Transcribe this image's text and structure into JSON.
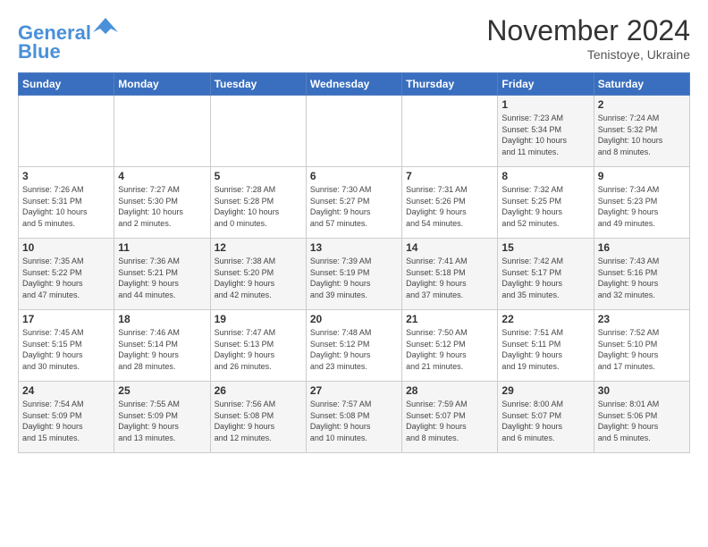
{
  "logo": {
    "line1": "General",
    "line2": "Blue"
  },
  "title": "November 2024",
  "location": "Tenistoye, Ukraine",
  "days_header": [
    "Sunday",
    "Monday",
    "Tuesday",
    "Wednesday",
    "Thursday",
    "Friday",
    "Saturday"
  ],
  "weeks": [
    [
      {
        "day": "",
        "info": ""
      },
      {
        "day": "",
        "info": ""
      },
      {
        "day": "",
        "info": ""
      },
      {
        "day": "",
        "info": ""
      },
      {
        "day": "",
        "info": ""
      },
      {
        "day": "1",
        "info": "Sunrise: 7:23 AM\nSunset: 5:34 PM\nDaylight: 10 hours\nand 11 minutes."
      },
      {
        "day": "2",
        "info": "Sunrise: 7:24 AM\nSunset: 5:32 PM\nDaylight: 10 hours\nand 8 minutes."
      }
    ],
    [
      {
        "day": "3",
        "info": "Sunrise: 7:26 AM\nSunset: 5:31 PM\nDaylight: 10 hours\nand 5 minutes."
      },
      {
        "day": "4",
        "info": "Sunrise: 7:27 AM\nSunset: 5:30 PM\nDaylight: 10 hours\nand 2 minutes."
      },
      {
        "day": "5",
        "info": "Sunrise: 7:28 AM\nSunset: 5:28 PM\nDaylight: 10 hours\nand 0 minutes."
      },
      {
        "day": "6",
        "info": "Sunrise: 7:30 AM\nSunset: 5:27 PM\nDaylight: 9 hours\nand 57 minutes."
      },
      {
        "day": "7",
        "info": "Sunrise: 7:31 AM\nSunset: 5:26 PM\nDaylight: 9 hours\nand 54 minutes."
      },
      {
        "day": "8",
        "info": "Sunrise: 7:32 AM\nSunset: 5:25 PM\nDaylight: 9 hours\nand 52 minutes."
      },
      {
        "day": "9",
        "info": "Sunrise: 7:34 AM\nSunset: 5:23 PM\nDaylight: 9 hours\nand 49 minutes."
      }
    ],
    [
      {
        "day": "10",
        "info": "Sunrise: 7:35 AM\nSunset: 5:22 PM\nDaylight: 9 hours\nand 47 minutes."
      },
      {
        "day": "11",
        "info": "Sunrise: 7:36 AM\nSunset: 5:21 PM\nDaylight: 9 hours\nand 44 minutes."
      },
      {
        "day": "12",
        "info": "Sunrise: 7:38 AM\nSunset: 5:20 PM\nDaylight: 9 hours\nand 42 minutes."
      },
      {
        "day": "13",
        "info": "Sunrise: 7:39 AM\nSunset: 5:19 PM\nDaylight: 9 hours\nand 39 minutes."
      },
      {
        "day": "14",
        "info": "Sunrise: 7:41 AM\nSunset: 5:18 PM\nDaylight: 9 hours\nand 37 minutes."
      },
      {
        "day": "15",
        "info": "Sunrise: 7:42 AM\nSunset: 5:17 PM\nDaylight: 9 hours\nand 35 minutes."
      },
      {
        "day": "16",
        "info": "Sunrise: 7:43 AM\nSunset: 5:16 PM\nDaylight: 9 hours\nand 32 minutes."
      }
    ],
    [
      {
        "day": "17",
        "info": "Sunrise: 7:45 AM\nSunset: 5:15 PM\nDaylight: 9 hours\nand 30 minutes."
      },
      {
        "day": "18",
        "info": "Sunrise: 7:46 AM\nSunset: 5:14 PM\nDaylight: 9 hours\nand 28 minutes."
      },
      {
        "day": "19",
        "info": "Sunrise: 7:47 AM\nSunset: 5:13 PM\nDaylight: 9 hours\nand 26 minutes."
      },
      {
        "day": "20",
        "info": "Sunrise: 7:48 AM\nSunset: 5:12 PM\nDaylight: 9 hours\nand 23 minutes."
      },
      {
        "day": "21",
        "info": "Sunrise: 7:50 AM\nSunset: 5:12 PM\nDaylight: 9 hours\nand 21 minutes."
      },
      {
        "day": "22",
        "info": "Sunrise: 7:51 AM\nSunset: 5:11 PM\nDaylight: 9 hours\nand 19 minutes."
      },
      {
        "day": "23",
        "info": "Sunrise: 7:52 AM\nSunset: 5:10 PM\nDaylight: 9 hours\nand 17 minutes."
      }
    ],
    [
      {
        "day": "24",
        "info": "Sunrise: 7:54 AM\nSunset: 5:09 PM\nDaylight: 9 hours\nand 15 minutes."
      },
      {
        "day": "25",
        "info": "Sunrise: 7:55 AM\nSunset: 5:09 PM\nDaylight: 9 hours\nand 13 minutes."
      },
      {
        "day": "26",
        "info": "Sunrise: 7:56 AM\nSunset: 5:08 PM\nDaylight: 9 hours\nand 12 minutes."
      },
      {
        "day": "27",
        "info": "Sunrise: 7:57 AM\nSunset: 5:08 PM\nDaylight: 9 hours\nand 10 minutes."
      },
      {
        "day": "28",
        "info": "Sunrise: 7:59 AM\nSunset: 5:07 PM\nDaylight: 9 hours\nand 8 minutes."
      },
      {
        "day": "29",
        "info": "Sunrise: 8:00 AM\nSunset: 5:07 PM\nDaylight: 9 hours\nand 6 minutes."
      },
      {
        "day": "30",
        "info": "Sunrise: 8:01 AM\nSunset: 5:06 PM\nDaylight: 9 hours\nand 5 minutes."
      }
    ]
  ]
}
